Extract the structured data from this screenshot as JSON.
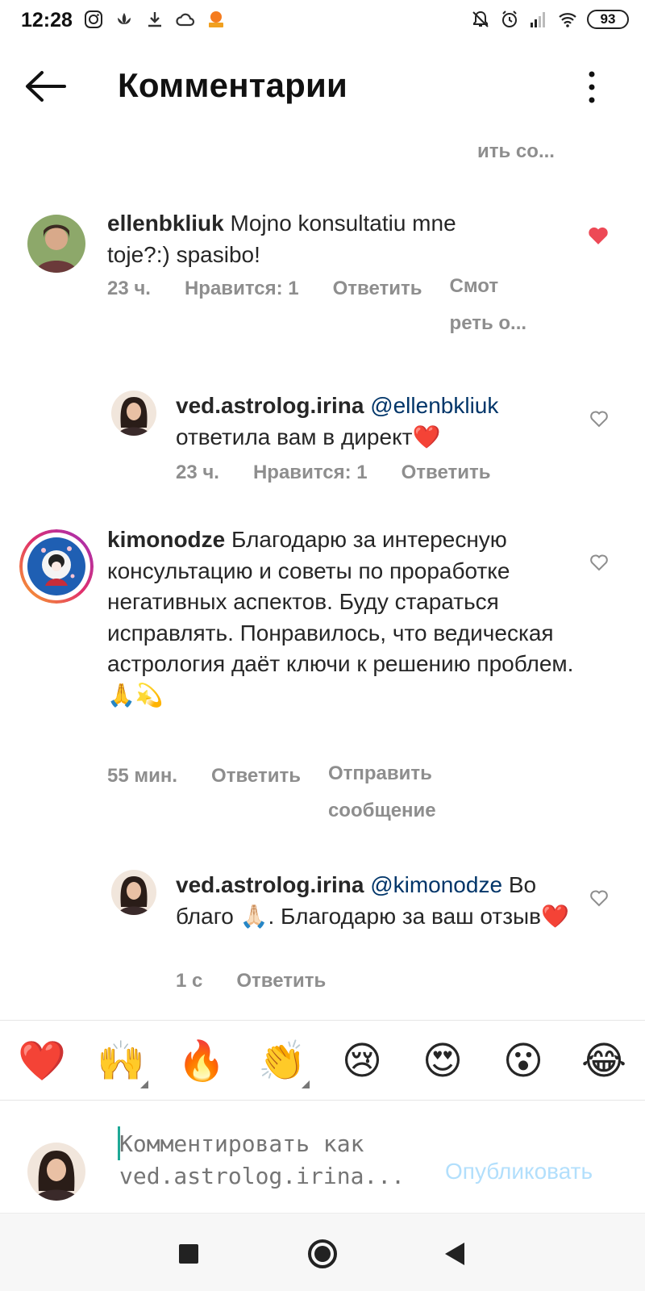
{
  "status_bar": {
    "time": "12:28",
    "battery": "93",
    "left_icons": [
      "instagram-icon",
      "lotus-icon",
      "download-icon",
      "cloud-icon",
      "app-icon"
    ],
    "right_icons": [
      "mute-icon",
      "alarm-icon",
      "signal-icon",
      "wifi-icon",
      "battery-icon"
    ]
  },
  "header": {
    "title": "Комментарии",
    "back_icon": "arrow-left-icon",
    "more_icon": "more-vertical-icon"
  },
  "see_more_top": "ить со...",
  "comments": [
    {
      "username": "ellenbkliuk",
      "text": "Mojno konsultatiu mne toje?:) spasibo!",
      "time": "23 ч.",
      "likes": "Нравится: 1",
      "reply": "Ответить",
      "extra": "Смот реть о...",
      "liked": true
    },
    {
      "username": "ved.astrolog.irina",
      "mention": "@ellenbkliuk",
      "text": "ответила вам в директ❤️",
      "time": "23 ч.",
      "likes": "Нравится: 1",
      "reply": "Ответить",
      "liked": false
    },
    {
      "username": "kimonodze",
      "text": "Благодарю за интересную консультацию и советы по проработке негативных аспектов. Буду стараться исправлять. Понравилось, что ведическая астрология даёт ключи к решению проблем. 🙏💫",
      "time": "55 мин.",
      "reply": "Ответить",
      "extra": "Отправить сообщение",
      "liked": false
    },
    {
      "username": "ved.astrolog.irina",
      "mention": "@kimonodze",
      "text": "Во благо 🙏🏻. Благодарю за ваш отзыв❤️",
      "time": "1 с",
      "reply": "Ответить",
      "liked": false
    }
  ],
  "emoji_bar": [
    "❤️",
    "🙌",
    "🔥",
    "👏",
    "😢",
    "😍",
    "😮",
    "😂"
  ],
  "comment_input": {
    "placeholder": "Комментировать как ved.astrolog.irina...",
    "publish": "Опубликовать"
  },
  "colors": {
    "liked_heart": "#ed4956",
    "mention": "#003569",
    "publish_disabled": "#b2dffc",
    "meta_gray": "#8e8e8e"
  }
}
